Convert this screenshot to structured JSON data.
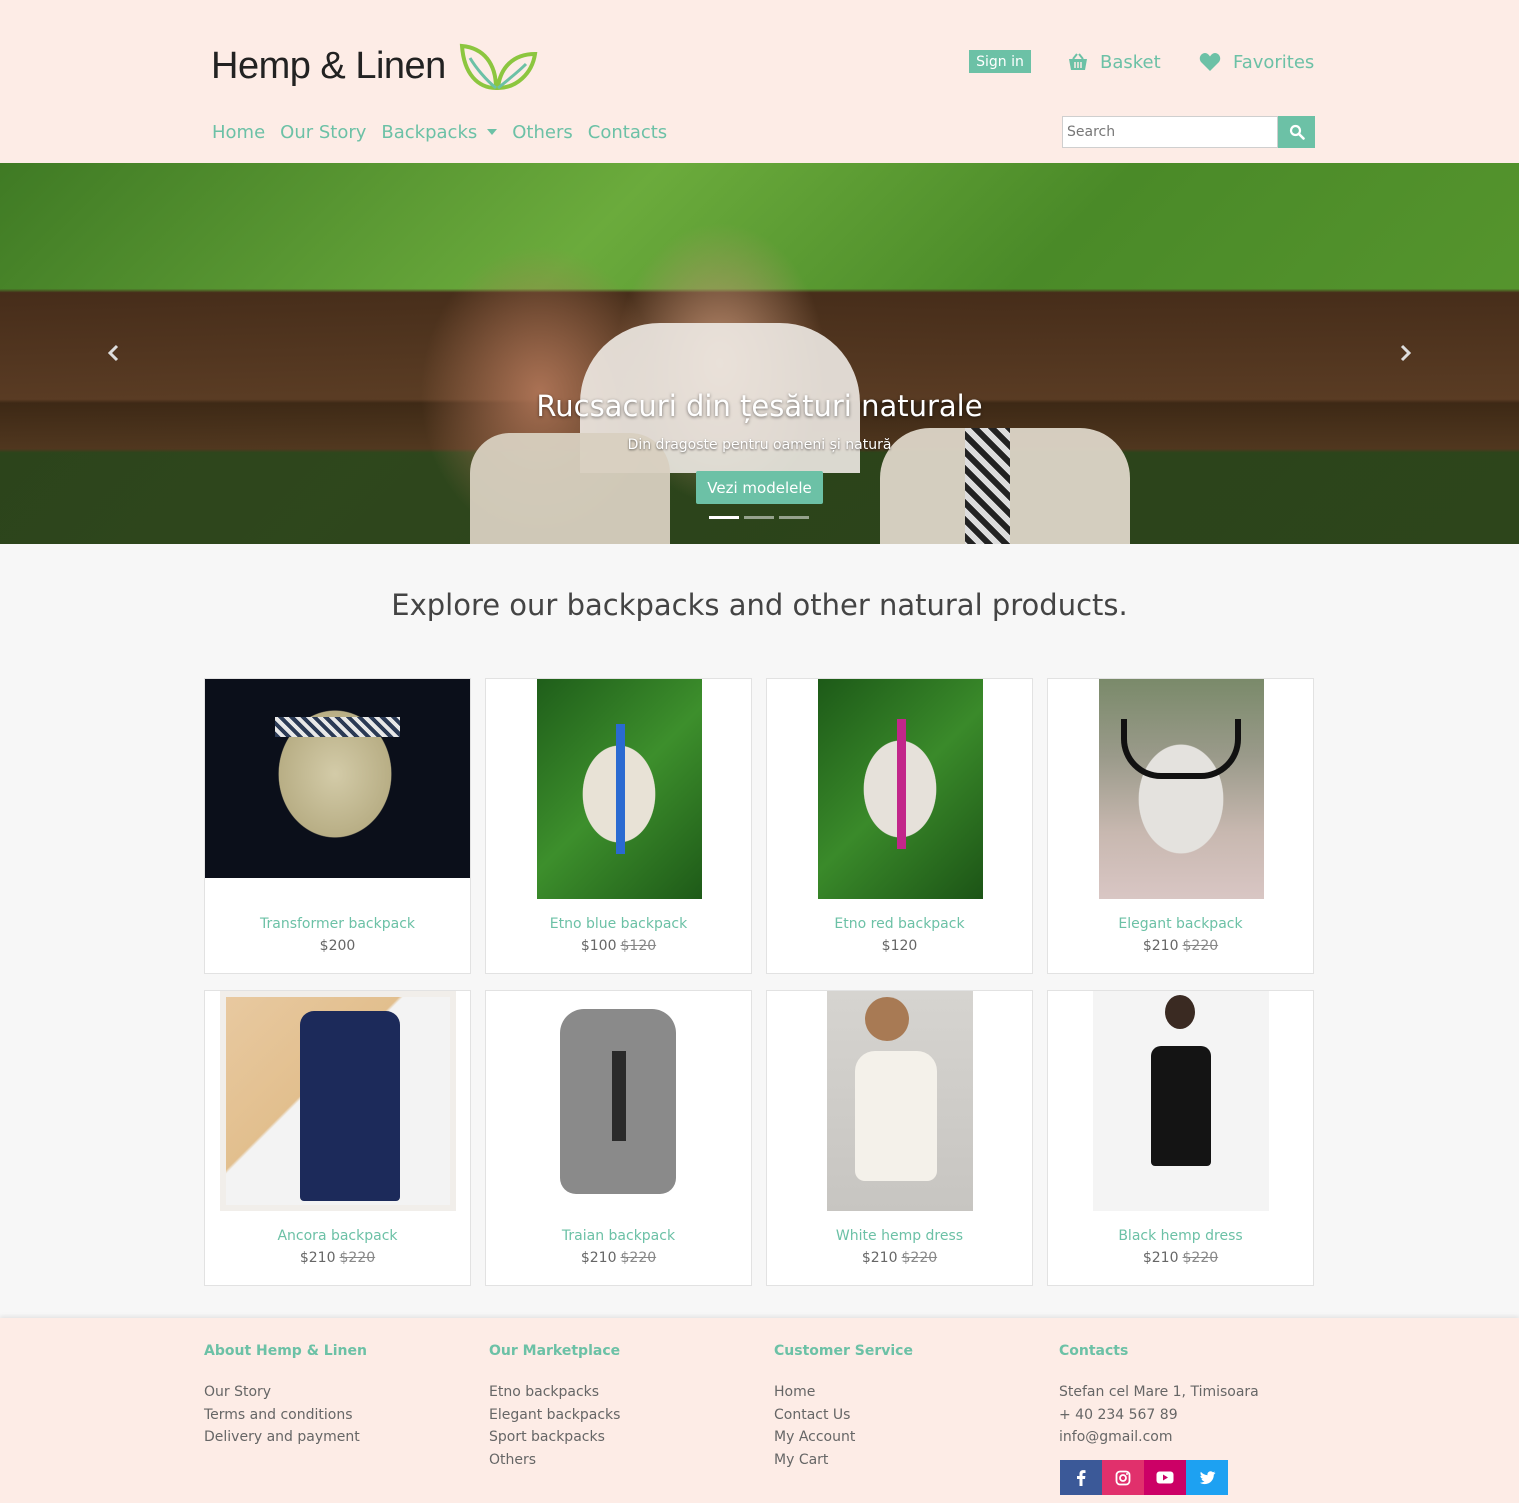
{
  "header": {
    "logo_text": "Hemp & Linen",
    "sign_in": "Sign in",
    "basket": "Basket",
    "favorites": "Favorites",
    "nav": [
      "Home",
      "Our Story",
      "Backpacks",
      "Others",
      "Contacts"
    ],
    "search_placeholder": "Search"
  },
  "hero": {
    "title": "Rucsacuri din țesături naturale",
    "subtitle": "Din dragoste pentru oameni și natură",
    "button": "Vezi modelele",
    "slides": 3,
    "active_slide": 1
  },
  "section_title": "Explore our backpacks and other natural products.",
  "products": [
    {
      "name": "Transformer backpack",
      "price": "$200",
      "old_price": ""
    },
    {
      "name": "Etno blue backpack",
      "price": "$100",
      "old_price": "$120"
    },
    {
      "name": "Etno red backpack",
      "price": "$120",
      "old_price": ""
    },
    {
      "name": "Elegant backpack",
      "price": "$210",
      "old_price": "$220"
    },
    {
      "name": "Ancora backpack",
      "price": "$210",
      "old_price": "$220"
    },
    {
      "name": "Traian backpack",
      "price": "$210",
      "old_price": "$220"
    },
    {
      "name": "White hemp dress",
      "price": "$210",
      "old_price": "$220"
    },
    {
      "name": "Black hemp dress",
      "price": "$210",
      "old_price": "$220"
    }
  ],
  "footer": {
    "about": {
      "title": "About Hemp & Linen",
      "items": [
        "Our Story",
        "Terms and conditions",
        "Delivery and payment"
      ]
    },
    "marketplace": {
      "title": "Our Marketplace",
      "items": [
        "Etno backpacks",
        "Elegant backpacks",
        "Sport backpacks",
        "Others"
      ]
    },
    "service": {
      "title": "Customer Service",
      "items": [
        "Home",
        "Contact Us",
        "My Account",
        "My Cart"
      ]
    },
    "contacts": {
      "title": "Contacts",
      "items": [
        "Stefan cel Mare 1, Timisoara",
        "+ 40 234 567 89",
        "info@gmail.com"
      ]
    }
  },
  "colors": {
    "accent": "#6cc1a6",
    "header_bg": "#fdece6",
    "facebook": "#3b5998",
    "instagram": "#e1306c",
    "youtube": "#cc0066",
    "twitter": "#1da1f2"
  }
}
